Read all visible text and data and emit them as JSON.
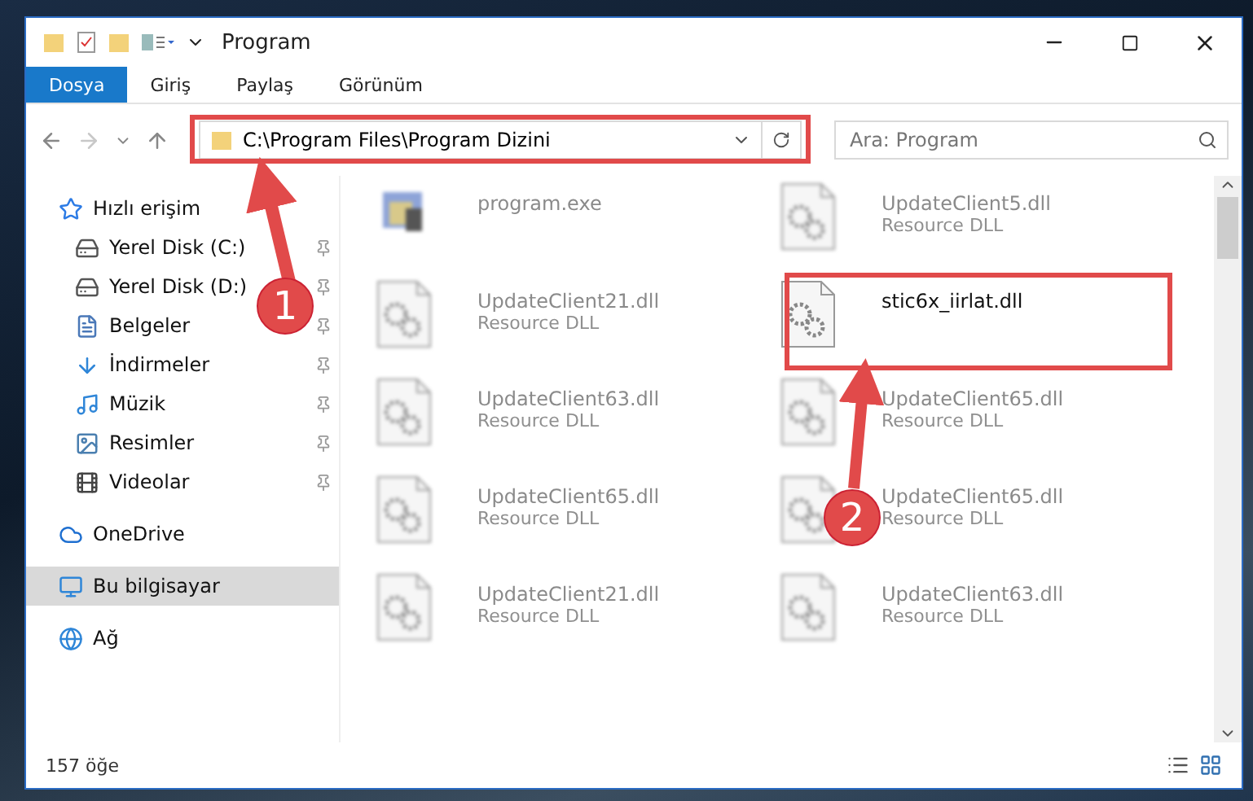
{
  "window": {
    "title": "Program"
  },
  "ribbon_tabs": [
    {
      "label": "Dosya",
      "selected": true
    },
    {
      "label": "Giriş",
      "selected": false
    },
    {
      "label": "Paylaş",
      "selected": false
    },
    {
      "label": "Görünüm",
      "selected": false
    }
  ],
  "address": {
    "path": "C:\\Program Files\\Program Dizini"
  },
  "search": {
    "placeholder": "Ara: Program"
  },
  "sidebar": {
    "items": [
      {
        "label": "Hızlı erişim",
        "kind": "star",
        "pinned": false,
        "selected": false,
        "children": [
          {
            "label": "Yerel Disk (C:)",
            "kind": "drive",
            "pinned": true,
            "selected": false
          },
          {
            "label": "Yerel Disk (D:)",
            "kind": "drive",
            "pinned": true,
            "selected": false
          },
          {
            "label": "Belgeler",
            "kind": "document",
            "pinned": true,
            "selected": false
          },
          {
            "label": "İndirmeler",
            "kind": "download",
            "pinned": true,
            "selected": false
          },
          {
            "label": "Müzik",
            "kind": "music",
            "pinned": true,
            "selected": false
          },
          {
            "label": "Resimler",
            "kind": "image",
            "pinned": true,
            "selected": false
          },
          {
            "label": "Videolar",
            "kind": "video",
            "pinned": true,
            "selected": false
          }
        ]
      },
      {
        "label": "OneDrive",
        "kind": "cloud",
        "pinned": false,
        "selected": false
      },
      {
        "label": "Bu bilgisayar",
        "kind": "computer",
        "pinned": false,
        "selected": true
      },
      {
        "label": "Ağ",
        "kind": "network",
        "pinned": false,
        "selected": false
      }
    ]
  },
  "files": [
    {
      "name": "program.exe",
      "kind": "exe",
      "blurred": true
    },
    {
      "name": "UpdateClient5.dll",
      "type": "Resource DLL",
      "kind": "dll",
      "blurred": true
    },
    {
      "name": "UpdateClient21.dll",
      "type": "Resource DLL",
      "kind": "dll",
      "blurred": true
    },
    {
      "name": "stic6x_iirlat.dll",
      "kind": "dll",
      "blurred": false
    },
    {
      "name": "UpdateClient63.dll",
      "type": "Resource DLL",
      "kind": "dll",
      "blurred": true
    },
    {
      "name": "UpdateClient65.dll",
      "type": "Resource DLL",
      "kind": "dll",
      "blurred": true
    },
    {
      "name": "UpdateClient65.dll",
      "type": "Resource DLL",
      "kind": "dll",
      "blurred": true
    },
    {
      "name": "UpdateClient65.dll",
      "type": "Resource DLL",
      "kind": "dll",
      "blurred": true
    },
    {
      "name": "UpdateClient21.dll",
      "type": "Resource DLL",
      "kind": "dll",
      "blurred": true
    },
    {
      "name": "UpdateClient63.dll",
      "type": "Resource DLL",
      "kind": "dll",
      "blurred": true
    }
  ],
  "status_bar": {
    "count": "157 öğe"
  },
  "annotations": [
    {
      "number": "1"
    },
    {
      "number": "2"
    }
  ]
}
